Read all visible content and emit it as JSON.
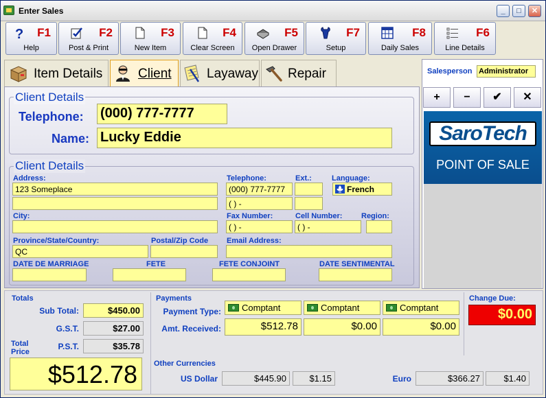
{
  "window": {
    "title": "Enter Sales",
    "minimize": "_",
    "maximize": "□",
    "close": "✕"
  },
  "toolbar": [
    {
      "key": "F1",
      "label": "Help",
      "icon": "help-icon"
    },
    {
      "key": "F2",
      "label": "Post & Print",
      "icon": "post-print-icon"
    },
    {
      "key": "F3",
      "label": "New Item",
      "icon": "new-item-icon"
    },
    {
      "key": "F4",
      "label": "Clear Screen",
      "icon": "clear-screen-icon"
    },
    {
      "key": "F5",
      "label": "Open Drawer",
      "icon": "drawer-icon"
    },
    {
      "key": "F7",
      "label": "Setup",
      "icon": "setup-icon"
    },
    {
      "key": "F8",
      "label": "Daily Sales",
      "icon": "daily-sales-icon"
    },
    {
      "key": "F6",
      "label": "Line Details",
      "icon": "line-details-icon"
    }
  ],
  "tabs": [
    {
      "label": "Item Details",
      "icon": "box-icon",
      "active": false
    },
    {
      "label": "Client",
      "icon": "client-icon",
      "active": true
    },
    {
      "label": "Layaway",
      "icon": "layaway-icon",
      "active": false
    },
    {
      "label": "Repair",
      "icon": "hammer-icon",
      "active": false
    }
  ],
  "client_summary": {
    "title": "Client Details",
    "telephone_label": "Telephone:",
    "telephone_value": "(000) 777-7777",
    "name_label": "Name:",
    "name_value": "Lucky Eddie"
  },
  "client_details": {
    "title": "Client Details",
    "address_label": "Address:",
    "address_line1": "123 Someplace",
    "address_line2": "",
    "city_label": "City:",
    "city_value": "",
    "province_label": "Province/State/Country:",
    "province_value": "QC",
    "postal_label": "Postal/Zip Code",
    "postal_value": "",
    "telephone_label": "Telephone:",
    "telephone_value": "(000) 777-7777",
    "telephone2_value": "(   )     -",
    "ext_label": "Ext.:",
    "ext_value": "",
    "language_label": "Language:",
    "language_value": "French",
    "fax_label": "Fax Number:",
    "fax_value": "(   )     -",
    "cell_label": "Cell Number:",
    "cell_value": "(   )     -",
    "region_label": "Region:",
    "region_value": "",
    "email_label": "Email Address:",
    "email_value": "",
    "marriage_label": "DATE DE MARRIAGE",
    "fete_label": "FETE",
    "fete_conjoint_label": "FETE CONJOINT",
    "date_sentimental_label": "DATE SENTIMENTAL"
  },
  "right_panel": {
    "salesperson_label": "Salesperson",
    "salesperson_value": "Administrator",
    "buttons": [
      "+",
      "−",
      "✔",
      "✕"
    ],
    "logo_brand": "SaroTech",
    "logo_sub": "POINT OF SALE"
  },
  "totals": {
    "title": "Totals",
    "subtotal_label": "Sub Total:",
    "subtotal_value": "$450.00",
    "gst_label": "G.S.T.",
    "gst_value": "$27.00",
    "pst_label": "P.S.T.",
    "pst_value": "$35.78",
    "total_label_1": "Total",
    "total_label_2": "Price",
    "total_value": "$512.78"
  },
  "payments": {
    "title": "Payments",
    "type_label": "Payment Type:",
    "received_label": "Amt. Received:",
    "types": [
      "Comptant",
      "Comptant",
      "Comptant"
    ],
    "received": [
      "$512.78",
      "$0.00",
      "$0.00"
    ]
  },
  "change": {
    "label": "Change Due:",
    "value": "$0.00"
  },
  "currencies": {
    "title": "Other Currencies",
    "usd_label": "US Dollar",
    "usd_amount": "$445.90",
    "usd_rate": "$1.15",
    "euro_label": "Euro",
    "euro_amount": "$366.27",
    "euro_rate": "$1.40"
  },
  "colors": {
    "label_blue": "#1040c0",
    "field_yellow": "#ffff99",
    "fkey_red": "#cc0000",
    "change_red": "#ee0000"
  }
}
